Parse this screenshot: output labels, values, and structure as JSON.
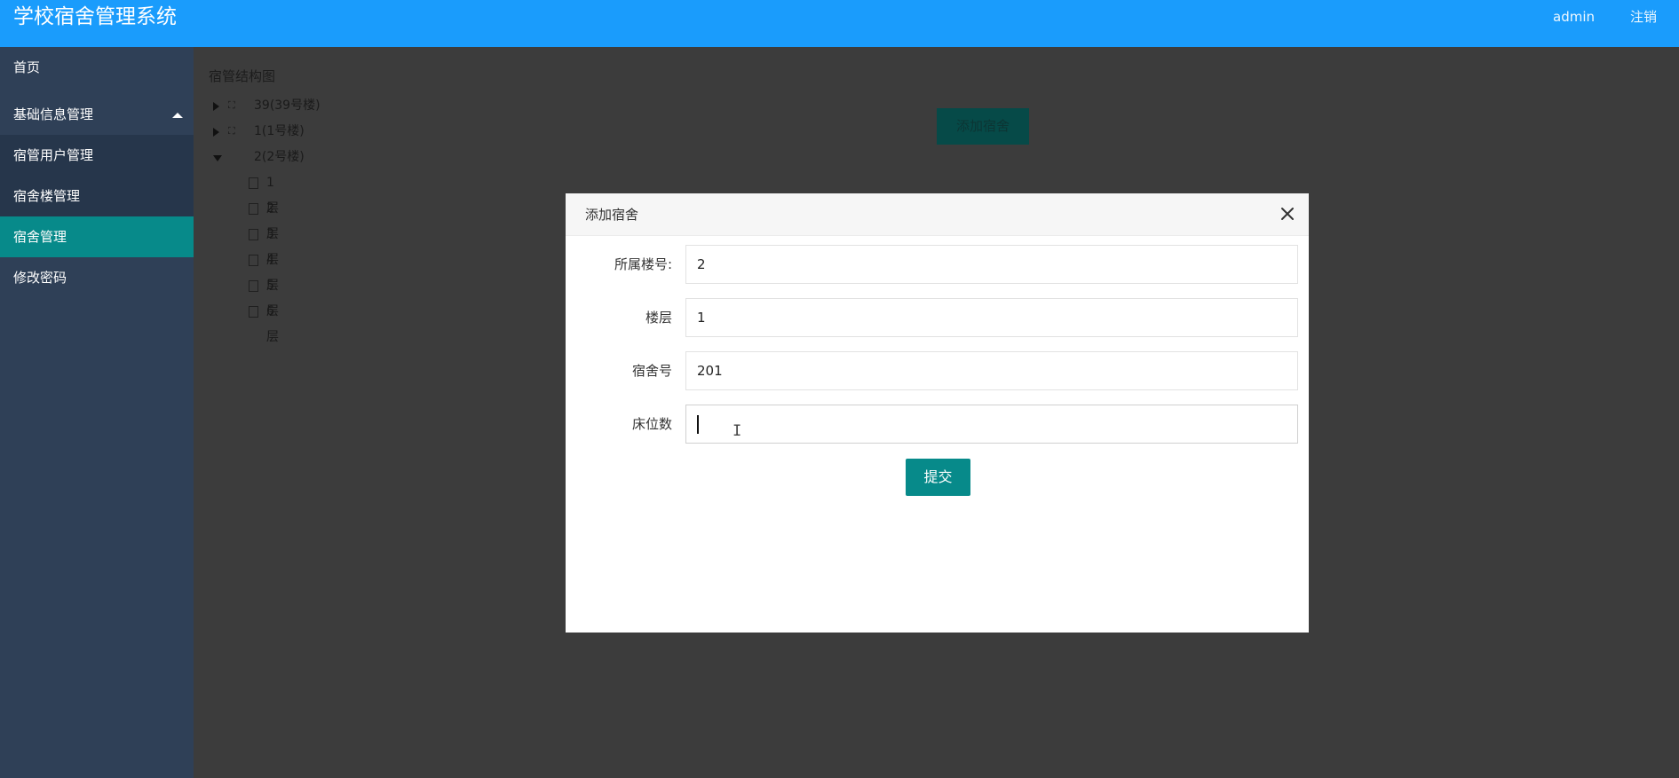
{
  "header": {
    "app_title": "学校宿舍管理系统",
    "user": "admin",
    "logout": "注销"
  },
  "sidebar": {
    "home": "首页",
    "group_label": "基础信息管理",
    "items": [
      {
        "label": "宿管用户管理"
      },
      {
        "label": "宿舍楼管理"
      },
      {
        "label": "宿舍管理",
        "active": true
      },
      {
        "label": "修改密码"
      }
    ]
  },
  "main": {
    "title": "宿管结构图",
    "add_button": "添加宿舍",
    "tree": [
      {
        "label": "39(39号楼)",
        "expanded": false
      },
      {
        "label": "1(1号楼)",
        "expanded": false
      },
      {
        "label": "2(2号楼)",
        "expanded": true,
        "children": [
          "1层",
          "2层",
          "3层",
          "4层",
          "5层",
          "6层"
        ]
      }
    ]
  },
  "modal": {
    "title": "添加宿舍",
    "fields": [
      {
        "label": "所属楼号:",
        "value": "2"
      },
      {
        "label": "楼层",
        "value": "1"
      },
      {
        "label": "宿舍号",
        "value": "201"
      },
      {
        "label": "床位数",
        "value": ""
      }
    ],
    "submit": "提交"
  },
  "colors": {
    "header": "#1a9cfc",
    "sidebar": "#2f4057",
    "active": "#078a8a"
  }
}
